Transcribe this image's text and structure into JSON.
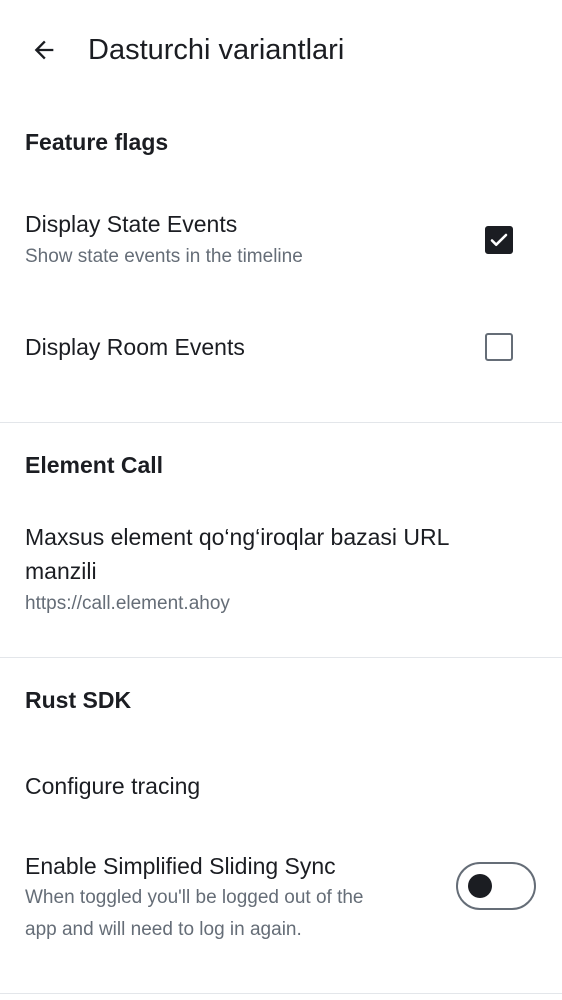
{
  "header": {
    "title": "Dasturchi variantlari"
  },
  "sections": {
    "feature_flags": {
      "title": "Feature flags",
      "display_state_events": {
        "label": "Display State Events",
        "description": "Show state events in the timeline",
        "checked": true
      },
      "display_room_events": {
        "label": "Display Room Events",
        "checked": false
      }
    },
    "element_call": {
      "title": "Element Call",
      "custom_url": {
        "label_line1": "Maxsus element qo‘ng‘iroqlar bazasi URL",
        "label_line2": "manzili",
        "value": "https://call.element.ahoy"
      }
    },
    "rust_sdk": {
      "title": "Rust SDK",
      "configure_tracing": {
        "label": "Configure tracing"
      },
      "simplified_sliding_sync": {
        "label": "Enable Simplified Sliding Sync",
        "description_line1": "When toggled you'll be logged out of the",
        "description_line2": "app and will need to log in again.",
        "enabled": false
      }
    }
  },
  "icons": {
    "back": "arrow-left-icon",
    "check": "checkmark-icon"
  },
  "colors": {
    "text_primary": "#1b1d22",
    "text_secondary": "#656d77",
    "divider": "#e3e6ea"
  }
}
